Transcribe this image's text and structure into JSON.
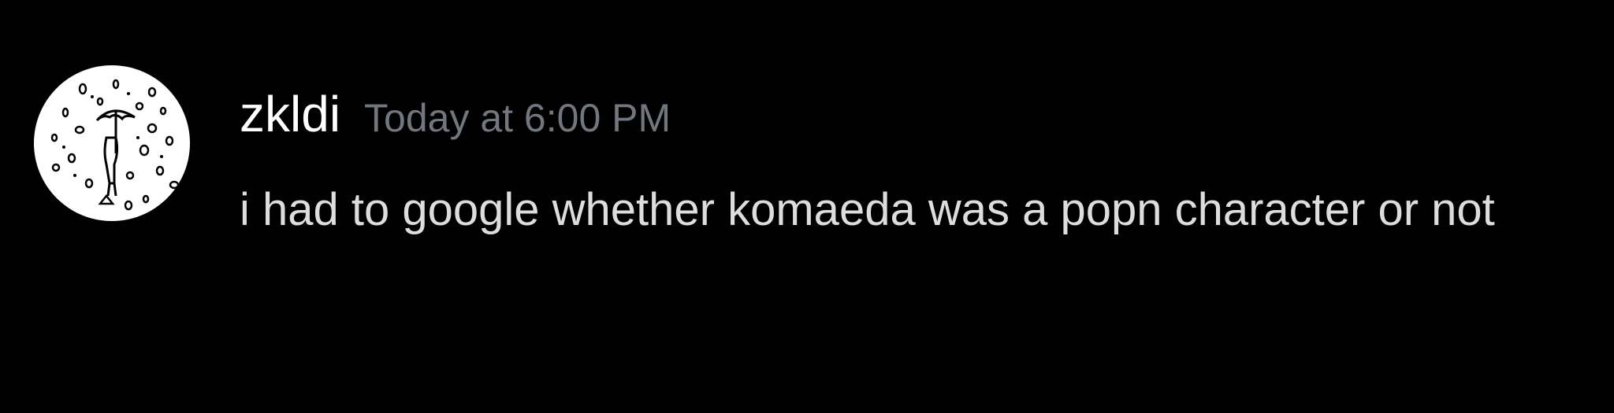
{
  "colors": {
    "background": "#000000",
    "username": "#ffffff",
    "timestamp": "#72767d",
    "message_text": "#dcddde"
  },
  "message": {
    "avatar": {
      "icon": "person-with-umbrella-in-rain-avatar"
    },
    "username": "zkldi",
    "timestamp": "Today at 6:00 PM",
    "text": "i had to google whether komaeda was a popn character or not"
  }
}
